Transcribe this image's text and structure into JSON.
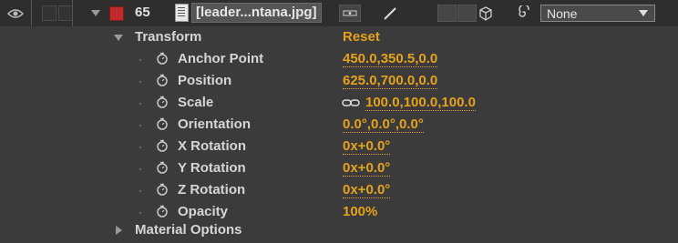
{
  "layer": {
    "number": "65",
    "name": "[leader...ntana.jpg]",
    "label_color": "#c02c2c",
    "mode": "None",
    "icons": [
      "eye-icon",
      "twirl-down-icon",
      "file-icon",
      "shy-switch-icon",
      "quality-slash-icon",
      "3d-cube-icon",
      "parent-spiral-icon"
    ]
  },
  "transform": {
    "label": "Transform",
    "reset_label": "Reset",
    "properties": [
      {
        "name": "Anchor Point",
        "value": "450.0,350.5,0.0"
      },
      {
        "name": "Position",
        "value": "625.0,700.0,0.0"
      },
      {
        "name": "Scale",
        "value": "100.0,100.0,100.0"
      },
      {
        "name": "Orientation",
        "value": "0.0°,0.0°,0.0°"
      },
      {
        "name": "X Rotation",
        "value": "0x+0.0°"
      },
      {
        "name": "Y Rotation",
        "value": "0x+0.0°"
      },
      {
        "name": "Z Rotation",
        "value": "0x+0.0°"
      },
      {
        "name": "Opacity",
        "value": "100%"
      }
    ]
  },
  "material_options": {
    "label": "Material Options"
  },
  "colors": {
    "value_orange": "#e6a21a",
    "background": "#3b3b3b",
    "header_bg": "#2e2e2e"
  }
}
